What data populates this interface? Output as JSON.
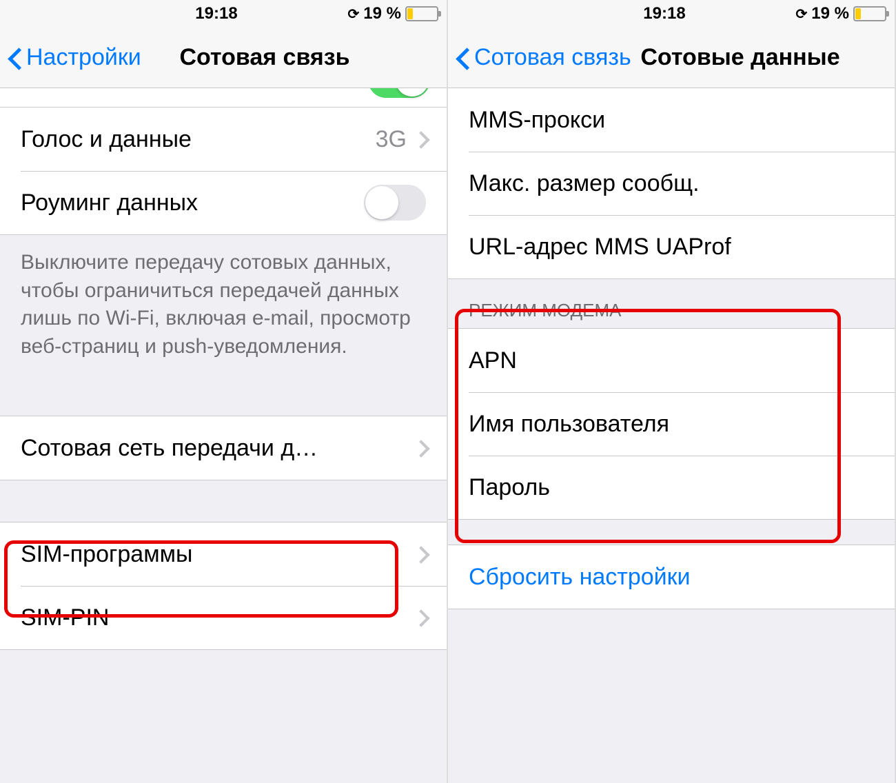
{
  "status": {
    "time": "19:18",
    "battery_text": "19 %",
    "battery_pct": 19
  },
  "screen1": {
    "back_label": "Настройки",
    "title": "Сотовая связь",
    "cells": {
      "voice_data_label": "Голос и данные",
      "voice_data_value": "3G",
      "roaming_label": "Роуминг данных",
      "data_network_label": "Сотовая сеть передачи д…",
      "sim_apps_label": "SIM-программы",
      "sim_pin_label": "SIM-PIN"
    },
    "footer": "Выключите передачу сотовых данных, чтобы ограничиться передачей данных лишь по Wi-Fi, включая e-mail, просмотр веб-страниц и push-уведомления."
  },
  "screen2": {
    "back_label": "Сотовая связь",
    "title": "Сотовые данные",
    "cells": {
      "mms_proxy": "MMS-прокси",
      "max_msg_size": "Макс. размер сообщ.",
      "mms_uaprof": "URL-адрес MMS UAProf",
      "section_modem": "РЕЖИМ МОДЕМА",
      "apn": "APN",
      "username": "Имя пользователя",
      "password": "Пароль",
      "reset": "Сбросить настройки"
    }
  }
}
